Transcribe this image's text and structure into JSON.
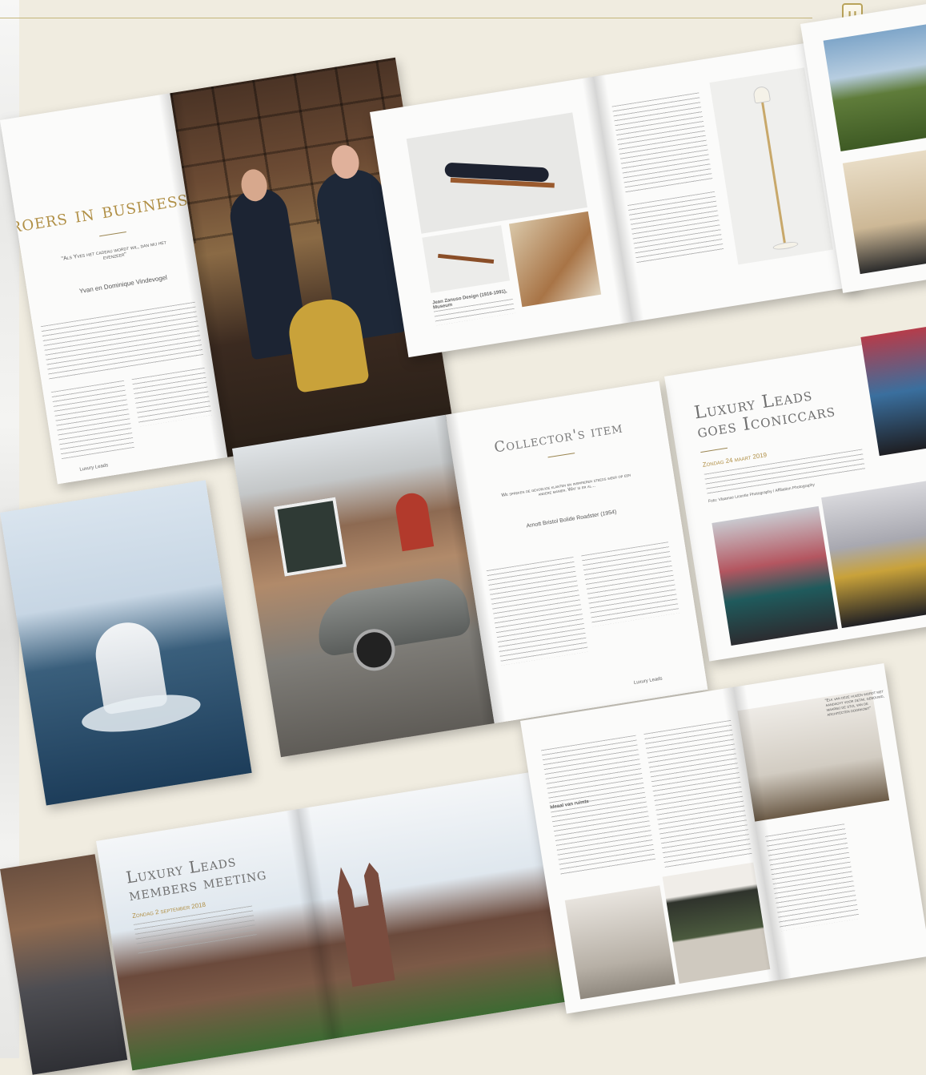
{
  "brand": {
    "logo_letter": "U",
    "accent": "#b9a35a"
  },
  "spreads": {
    "broers": {
      "title": "roers in business",
      "quote": "\"Als Yves het cadeau wordt wil, dan mij het evenzeer\"",
      "byline": "Yvan en Dominique Vindevogel",
      "folio": "Luxury Leads"
    },
    "furniture": {
      "caption": "Jean Zanuso Design (1916-1991), Museum"
    },
    "collectors": {
      "title": "Collector's item",
      "intro": "We spreken de gevoelige klanten en inspireren steeds weer op een andere manier. Wat is er al...",
      "subtitle": "Arnott Bristol Bolide Roadster (1954)",
      "folio": "Luxury Leads"
    },
    "iconiccars": {
      "title_line1": "Luxury Leads",
      "title_line2": "goes Iconiccars",
      "date": "Zondag 24 maart 2019",
      "credit": "Foto: Vlaamse Licentie Photography / Affiliation Photography"
    },
    "members": {
      "title_line1": "Luxury Leads",
      "title_line2": "members meeting",
      "date": "Zondag 2 september 2018"
    },
    "interior": {
      "quote": "\"Elk van deze huizen wordt met aandacht voor detail gebouwd, waarbij de stijl van de architecten doorkomt\"",
      "subhead": "Ideaal van ruimte"
    }
  }
}
